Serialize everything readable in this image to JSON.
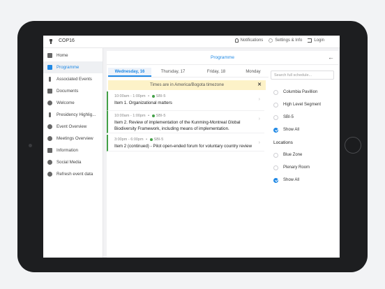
{
  "topbar": {
    "title": "COP16",
    "notifications": "Notifications",
    "settings": "Settings & Info",
    "login": "Login"
  },
  "sidebar": {
    "items": [
      {
        "label": "Home",
        "icon": "home-icon"
      },
      {
        "label": "Programme",
        "icon": "calendar-icon",
        "active": true
      },
      {
        "label": "Associated Events",
        "icon": "info-icon"
      },
      {
        "label": "Documents",
        "icon": "folder-icon"
      },
      {
        "label": "Welcome",
        "icon": "hand-icon"
      },
      {
        "label": "Presidency Highlig...",
        "icon": "info-icon"
      },
      {
        "label": "Event Overview",
        "icon": "eye-icon"
      },
      {
        "label": "Meetings Overview",
        "icon": "eye-icon"
      },
      {
        "label": "Information",
        "icon": "folder-icon"
      },
      {
        "label": "Social Media",
        "icon": "star-icon"
      },
      {
        "label": "Refresh event data",
        "icon": "refresh-icon"
      }
    ]
  },
  "panel": {
    "title": "Programme",
    "back_icon": "arrow-left-icon"
  },
  "tabs": [
    "Wednesday, 16",
    "Thursday, 17",
    "Friday, 18",
    "Monday"
  ],
  "timezone_banner": "Times are in America/Bogota timezone",
  "sessions": [
    {
      "time": "10:00am - 1:00pm",
      "tag": "SBI-5",
      "title": "Item 1. Organizational matters"
    },
    {
      "time": "10:00am - 1:00pm",
      "tag": "SBI-5",
      "title": "Item 2. Review of implementation of the Kunming-Montreal Global Biodiversity Framework, including means of implementation."
    },
    {
      "time": "3:00pm - 6:00pm",
      "tag": "SBI-5",
      "title": "Item 2 (continued) - Pilot open-ended forum for voluntary country review"
    }
  ],
  "filters": {
    "search_placeholder": "Search full schedule...",
    "tracks": [
      "Columbia Pavillion",
      "High Level Segment",
      "SBI-5",
      "Show All"
    ],
    "locations_heading": "Locations",
    "locations": [
      "Blue Zone",
      "Plenary Room",
      "Show All"
    ]
  },
  "colors": {
    "accent": "#1e88e5",
    "session_bar": "#43a047",
    "banner": "#fdf2c8"
  }
}
